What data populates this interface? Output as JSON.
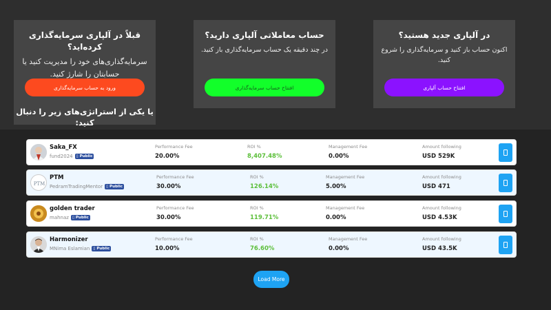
{
  "cards": [
    {
      "title": "در آلپاری جدید هستید؟",
      "desc": "اکنون حساب باز کنید و سرمایه‌گذاری را شروع کنید.",
      "button": "افتتاح حساب آلپاری",
      "color": "#8b12ff"
    },
    {
      "title": "حساب معاملاتی آلپاری دارید؟",
      "desc": "در چند دقیقه یک حساب سرمایه‌گذاری باز کنید.",
      "button": "افتتاح حساب سرمایه‌گذاری",
      "color": "#12ff2a"
    },
    {
      "title": "قبلاً در آلپاری سرمایه‌گذاری کرده‌اید؟",
      "desc": "سرمایه‌گذاری‌های خود را مدیریت کنید یا حسابتان را شارژ کنید.",
      "button": "ورود به حساب سرمایه‌گذاری",
      "color": "#fd4a1f",
      "extra": "یا یکی از استراتژی‌های زیر را دنبال کنید:"
    }
  ],
  "labels": {
    "performance_fee": "Performance Fee",
    "roi": "ROI %",
    "management_fee": "Management Fee",
    "amount_following": "Amount following",
    "public_badge": "Public"
  },
  "strategies": [
    {
      "name": "Saka_FX",
      "username": "fund2024",
      "performance_fee": "20.00%",
      "roi": "8,407.48%",
      "management_fee": "0.00%",
      "amount": "USD 529K",
      "row_bg": "#ffffff"
    },
    {
      "name": "PTM",
      "username": "PedramTradingMentor",
      "performance_fee": "30.00%",
      "roi": "126.14%",
      "management_fee": "5.00%",
      "amount": "USD 471",
      "row_bg": "#eef7ff"
    },
    {
      "name": "golden trader",
      "username": "mahnaz",
      "performance_fee": "30.00%",
      "roi": "119.71%",
      "management_fee": "0.00%",
      "amount": "USD 4.53K",
      "row_bg": "#ffffff"
    },
    {
      "name": "Harmonizer",
      "username": "MNima Eslamian",
      "performance_fee": "10.00%",
      "roi": "76.60%",
      "management_fee": "0.00%",
      "amount": "USD 43.5K",
      "row_bg": "#eef7ff"
    }
  ],
  "avatar_text": {
    "ptm": "PTM"
  },
  "load_more": "Load More",
  "colors": {
    "accent": "#1ea3f3",
    "roi_green": "#5cbf3a",
    "badge": "#2d4f9e"
  }
}
